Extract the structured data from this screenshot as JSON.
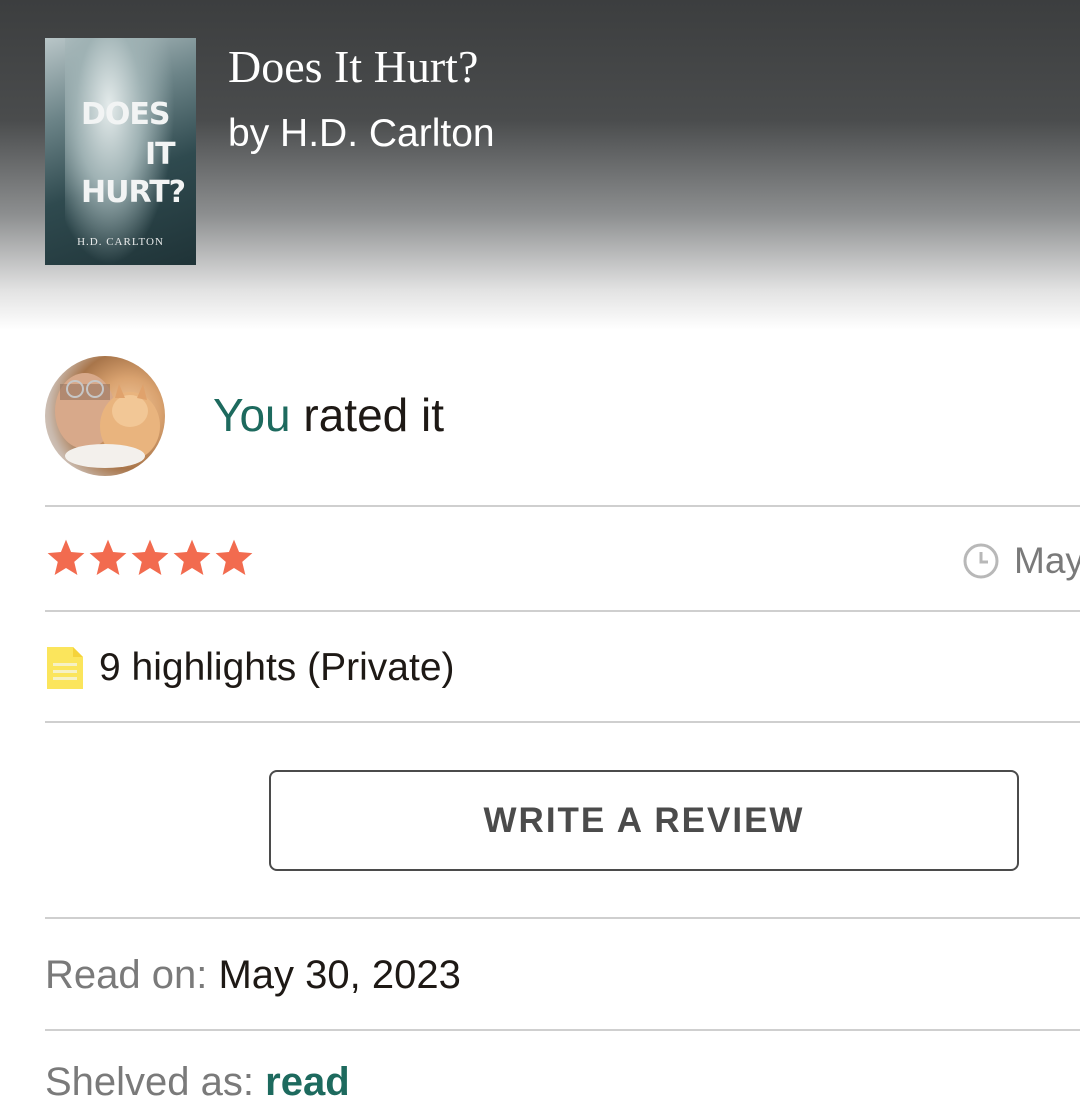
{
  "book": {
    "title": "Does It Hurt?",
    "author": "by H.D. Carlton",
    "cover": {
      "title_lines": [
        "DOES",
        "IT",
        "HURT?"
      ],
      "author": "H.D. CARLTON"
    }
  },
  "rating": {
    "you_label": "You",
    "rated_text": " rated it",
    "stars": 5,
    "max_stars": 5,
    "star_color": "#f26b4f",
    "date_text": "May"
  },
  "highlights": {
    "text": "9 highlights (Private)"
  },
  "review_button": {
    "label": "WRITE A REVIEW"
  },
  "read_on": {
    "label": "Read on:",
    "value": "May 30, 2023"
  },
  "shelved": {
    "label": "Shelved as:",
    "value": "read"
  },
  "colors": {
    "accent_green": "#1d6a5e",
    "star_orange": "#f26b4f",
    "note_yellow": "#fbe55c"
  },
  "icons": {
    "rating_time": "clock-icon",
    "highlights": "note-icon"
  }
}
